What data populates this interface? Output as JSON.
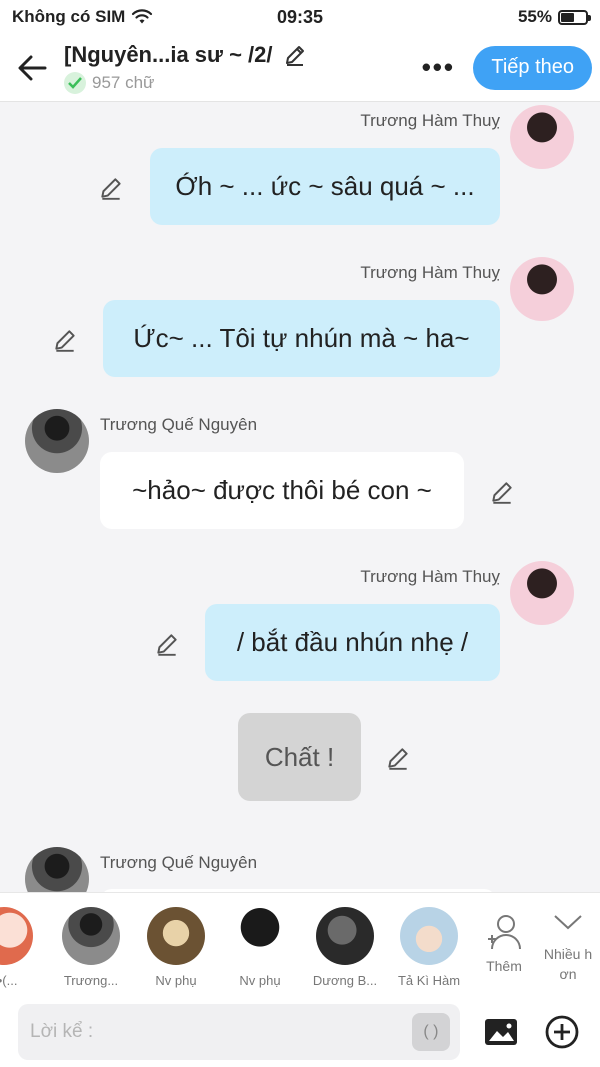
{
  "status": {
    "carrier": "Không có SIM",
    "time": "09:35",
    "battery": "55%",
    "battery_level": 0.55
  },
  "header": {
    "title": "[Nguyên...ia sư ~ /2/",
    "word_count": "957 chữ",
    "next_label": "Tiếp theo"
  },
  "messages": [
    {
      "speaker": "Trương Hàm Thuỵ",
      "text": "Ớh ~ ... ức ~ sâu quá ~ ..."
    },
    {
      "speaker": "Trương Hàm Thuỵ",
      "text": "Ức~ ... Tôi tự nhún mà ~ ha~"
    },
    {
      "speaker": "Trương Quế Nguyên",
      "text": "~hảo~ được thôi bé con ~"
    },
    {
      "speaker": "Trương Hàm Thuỵ",
      "text": "/ bắt đầu nhún nhẹ /"
    },
    {
      "speaker": "",
      "text": "Chất !"
    },
    {
      "speaker": "Trương Quế Nguyên",
      "text": ""
    }
  ],
  "characters": [
    {
      "name": "n•(..."
    },
    {
      "name": "Trương..."
    },
    {
      "name": "Nv phụ"
    },
    {
      "name": "Nv phụ"
    },
    {
      "name": "Dương B..."
    },
    {
      "name": "Tả Kì Hàm"
    }
  ],
  "add_character_label": "Thêm",
  "more_characters_label": "Nhiều h ơn",
  "input": {
    "placeholder": "Lời kể :",
    "paren_label": "( )"
  }
}
